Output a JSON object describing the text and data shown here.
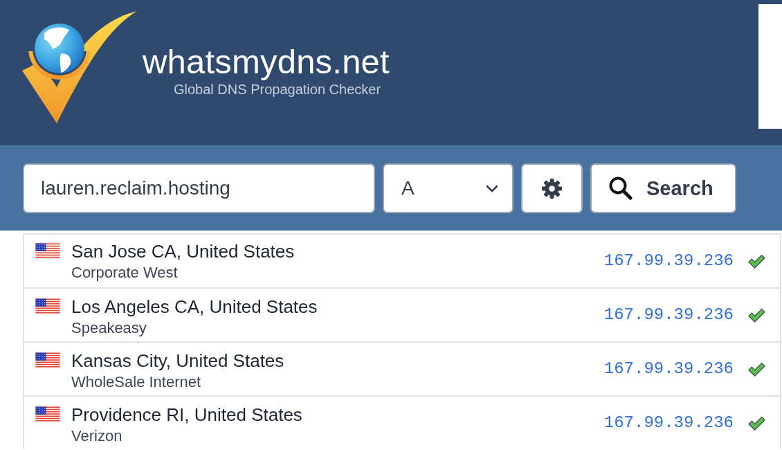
{
  "header": {
    "site_title": "whatsmydns.net",
    "tagline": "Global DNS Propagation Checker"
  },
  "search": {
    "query": "lauren.reclaim.hosting",
    "record_type": "A",
    "button": "Search"
  },
  "results": [
    {
      "location": "San Jose CA, United States",
      "provider": "Corporate West",
      "ip": "167.99.39.236",
      "resolved": true
    },
    {
      "location": "Los Angeles CA, United States",
      "provider": "Speakeasy",
      "ip": "167.99.39.236",
      "resolved": true
    },
    {
      "location": "Kansas City, United States",
      "provider": "WholeSale Internet",
      "ip": "167.99.39.236",
      "resolved": true
    },
    {
      "location": "Providence RI, United States",
      "provider": "Verizon",
      "ip": "167.99.39.236",
      "resolved": true
    }
  ]
}
